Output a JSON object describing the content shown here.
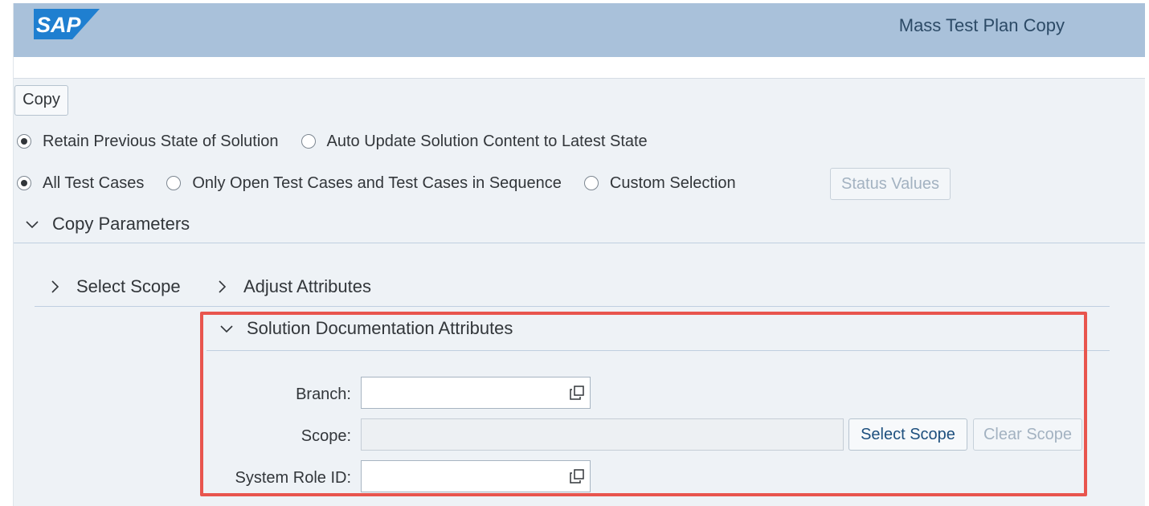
{
  "shell": {
    "logo_text": "SAP",
    "title": "Mass Test Plan Copy",
    "brand_color": "#a9c1da"
  },
  "toolbar": {
    "copy_label": "Copy"
  },
  "state_options": {
    "items": [
      {
        "label": "Retain Previous State of Solution",
        "selected": true
      },
      {
        "label": "Auto Update Solution Content to Latest State",
        "selected": false
      }
    ]
  },
  "testcase_options": {
    "items": [
      {
        "label": "All Test Cases",
        "selected": true
      },
      {
        "label": "Only Open Test Cases and Test Cases in Sequence",
        "selected": false
      },
      {
        "label": "Custom Selection",
        "selected": false
      }
    ],
    "status_values_label": "Status Values"
  },
  "copy_parameters": {
    "title": "Copy Parameters",
    "tabs": [
      {
        "label": "Select Scope",
        "icon": "chevron-right-icon"
      },
      {
        "label": "Adjust Attributes",
        "icon": "chevron-right-icon"
      }
    ]
  },
  "solution_doc": {
    "title": "Solution Documentation Attributes",
    "highlight_color": "#e8554e",
    "branch_label": "Branch:",
    "branch_value": "",
    "scope_label": "Scope:",
    "scope_value": "",
    "select_scope_label": "Select Scope",
    "clear_scope_label": "Clear Scope",
    "system_role_label": "System Role ID:",
    "system_role_value": ""
  }
}
